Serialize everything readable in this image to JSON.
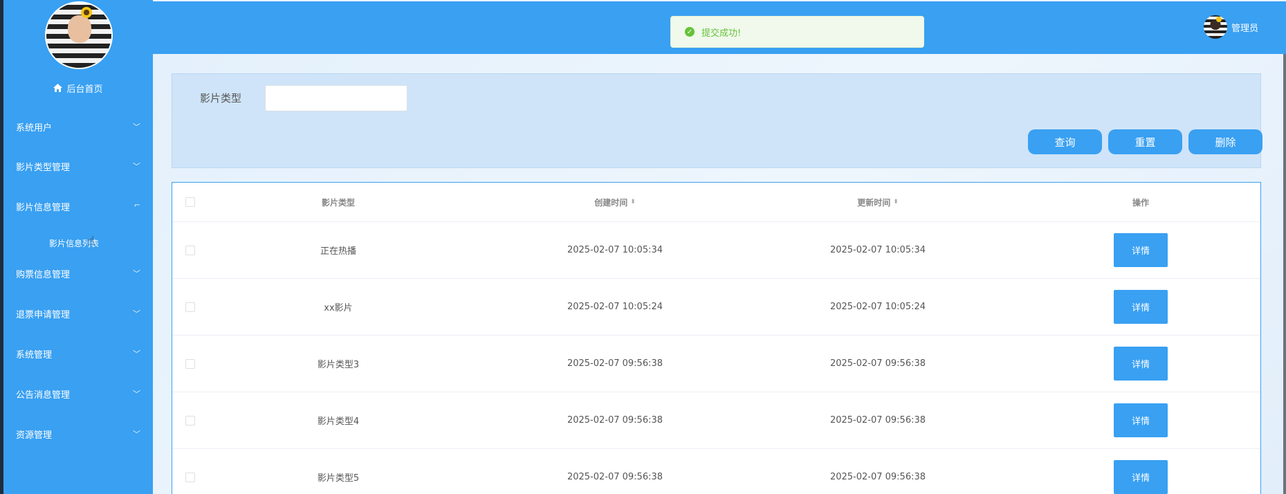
{
  "sidebar": {
    "home_label": "后台首页",
    "menus": [
      {
        "label": "系统用户"
      },
      {
        "label": "影片类型管理"
      },
      {
        "label": "影片信息管理"
      },
      {
        "label": "购票信息管理"
      },
      {
        "label": "退票申请管理"
      },
      {
        "label": "系统管理"
      },
      {
        "label": "公告消息管理"
      },
      {
        "label": "资源管理"
      }
    ],
    "submenu_item": "影片信息列表"
  },
  "header": {
    "toast_message": "提交成功!",
    "user_name": "管理员"
  },
  "search": {
    "label": "影片类型",
    "input_value": "",
    "buttons": {
      "query": "查询",
      "reset": "重置",
      "delete": "删除"
    }
  },
  "table": {
    "columns": [
      "影片类型",
      "创建时间",
      "更新时间",
      "操作"
    ],
    "sort_icon": "⬍",
    "rows": [
      {
        "type": "正在热播",
        "created": "2025-02-07 10:05:34",
        "updated": "2025-02-07 10:05:34",
        "action": "详情"
      },
      {
        "type": "xx影片",
        "created": "2025-02-07 10:05:24",
        "updated": "2025-02-07 10:05:24",
        "action": "详情"
      },
      {
        "type": "影片类型3",
        "created": "2025-02-07 09:56:38",
        "updated": "2025-02-07 09:56:38",
        "action": "详情"
      },
      {
        "type": "影片类型4",
        "created": "2025-02-07 09:56:38",
        "updated": "2025-02-07 09:56:38",
        "action": "详情"
      },
      {
        "type": "影片类型5",
        "created": "2025-02-07 09:56:38",
        "updated": "2025-02-07 09:56:38",
        "action": "详情"
      }
    ]
  },
  "colors": {
    "primary": "#39a0f2",
    "success": "#67c23a",
    "sidebar_edge": "#1f2d3d"
  }
}
